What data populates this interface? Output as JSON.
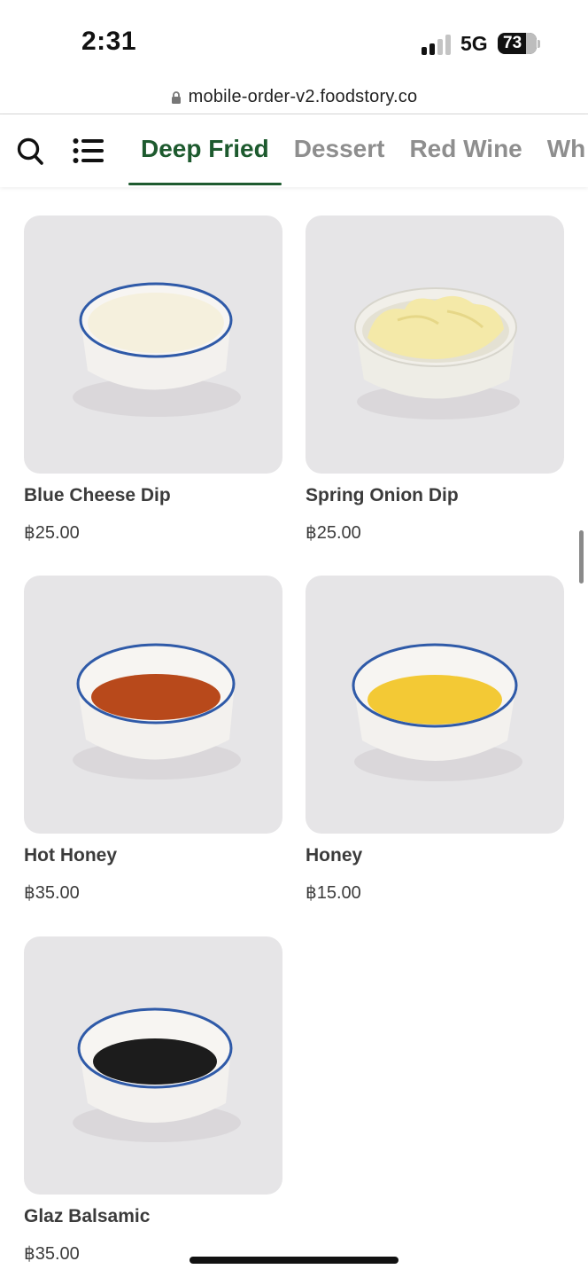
{
  "status_bar": {
    "time": "2:31",
    "network": "5G",
    "battery": "73"
  },
  "browser": {
    "url": "mobile-order-v2.foodstory.co"
  },
  "nav": {
    "tabs": [
      {
        "label": "Deep Fried",
        "active": true
      },
      {
        "label": "Dessert",
        "active": false
      },
      {
        "label": "Red Wine",
        "active": false
      },
      {
        "label": "Wh",
        "active": false
      }
    ],
    "accent_color": "#1d5a2e"
  },
  "products": [
    {
      "name": "Blue Cheese Dip",
      "price": "฿25.00",
      "icon": "blue-cheese-dip-image"
    },
    {
      "name": "Spring Onion Dip",
      "price": "฿25.00",
      "icon": "spring-onion-dip-image"
    },
    {
      "name": "Hot Honey",
      "price": "฿35.00",
      "icon": "hot-honey-image"
    },
    {
      "name": "Honey",
      "price": "฿15.00",
      "icon": "honey-image"
    },
    {
      "name": "Glaz Balsamic",
      "price": "฿35.00",
      "icon": "glaz-balsamic-image"
    }
  ]
}
